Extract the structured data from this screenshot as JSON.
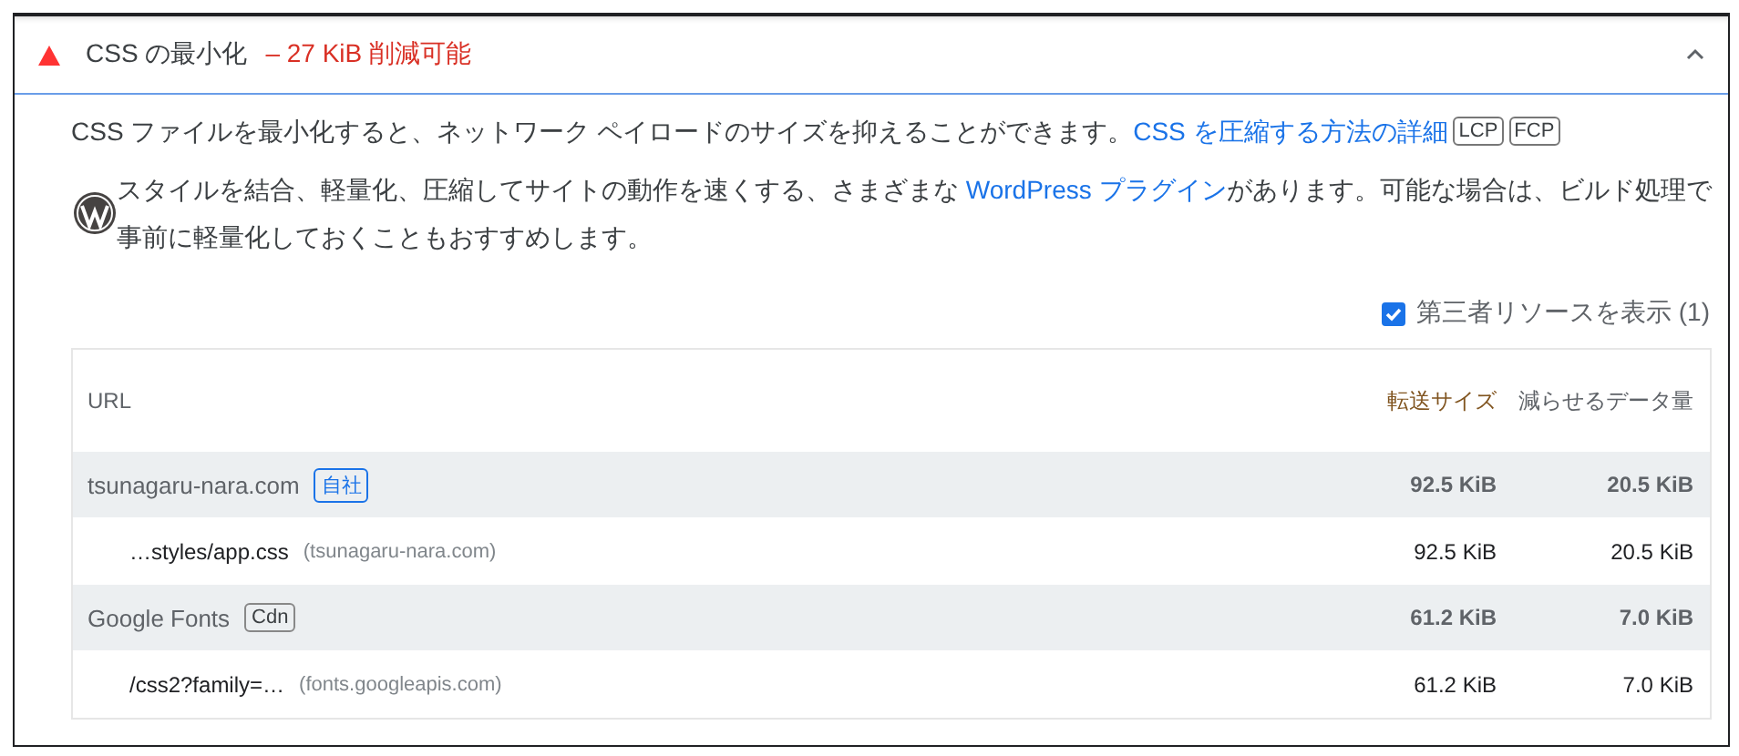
{
  "audit": {
    "title": "CSS の最小化",
    "savings": "– 27 KiB 削減可能",
    "expanded": true,
    "description": {
      "text": "CSS ファイルを最小化すると、ネットワーク ペイロードのサイズを抑えることができます。",
      "link": "CSS を圧縮する方法の詳細",
      "badges": [
        "LCP",
        "FCP"
      ]
    },
    "stack_pack": {
      "before": "スタイルを結合、軽量化、圧縮してサイトの動作を速くする、さまざまな ",
      "link": "WordPress プラグイン",
      "after": "があります。可能な場合は、ビルド処理で事前に軽量化しておくこともおすすめします。"
    },
    "third_party": {
      "label": "第三者リソースを表示 (1)",
      "checked": true
    },
    "table": {
      "columns": [
        "URL",
        "転送サイズ",
        "減らせるデータ量"
      ],
      "groups": [
        {
          "entity": "tsunagaru-nara.com",
          "badge": {
            "text": "自社",
            "kind": "first-party"
          },
          "transfer": "92.5 KiB",
          "savings": "20.5 KiB",
          "children": [
            {
              "url": "…styles/app.css",
              "host": "(tsunagaru-nara.com)",
              "transfer": "92.5 KiB",
              "savings": "20.5 KiB"
            }
          ]
        },
        {
          "entity": "Google Fonts",
          "badge": {
            "text": "Cdn",
            "kind": "cdn"
          },
          "transfer": "61.2 KiB",
          "savings": "7.0 KiB",
          "children": [
            {
              "url": "/css2?family=…",
              "host": "(fonts.googleapis.com)",
              "transfer": "61.2 KiB",
              "savings": "7.0 KiB"
            }
          ]
        }
      ]
    }
  }
}
